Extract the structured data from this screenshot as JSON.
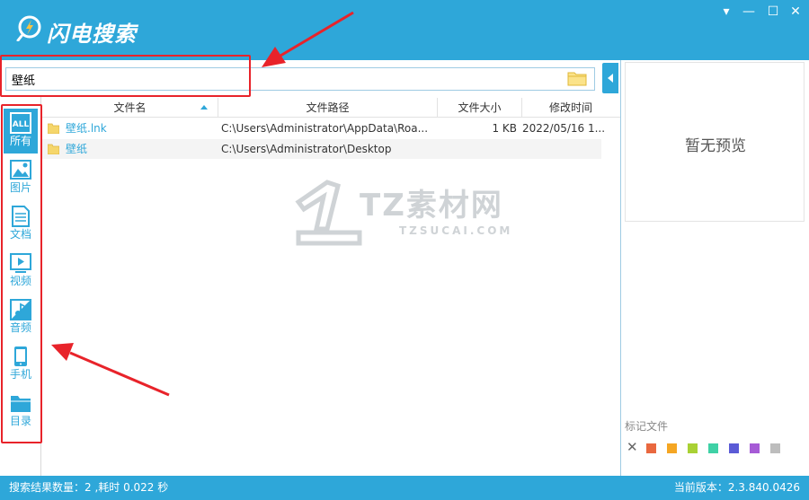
{
  "app": {
    "title": "闪电搜索"
  },
  "search": {
    "value": "壁纸",
    "placeholder": ""
  },
  "categories": [
    {
      "label": "所有",
      "icon": "all-icon",
      "active": true
    },
    {
      "label": "图片",
      "icon": "image-icon"
    },
    {
      "label": "文档",
      "icon": "document-icon"
    },
    {
      "label": "视频",
      "icon": "video-icon"
    },
    {
      "label": "音频",
      "icon": "audio-icon"
    },
    {
      "label": "手机",
      "icon": "phone-icon"
    },
    {
      "label": "目录",
      "icon": "folder-icon"
    }
  ],
  "table": {
    "columns": {
      "name": "文件名",
      "path": "文件路径",
      "size": "文件大小",
      "date": "修改时间"
    },
    "rows": [
      {
        "name": "壁纸.lnk",
        "path": "C:\\Users\\Administrator\\AppData\\Roa...",
        "size": "1 KB",
        "date": "2022/05/16 1..."
      },
      {
        "name": "壁纸",
        "path": "C:\\Users\\Administrator\\Desktop",
        "size": "",
        "date": ""
      }
    ]
  },
  "preview": {
    "empty_text": "暂无预览"
  },
  "marks": {
    "title": "标记文件",
    "colors": [
      "#e9683f",
      "#f5a623",
      "#a9d134",
      "#3fd1a6",
      "#5b5bd6",
      "#a65bd6",
      "#bdbdbd"
    ]
  },
  "watermark": {
    "text": "TZ素材网",
    "sub": "TZSUCAI.COM"
  },
  "status": {
    "left": "搜索结果数量：2 ,耗时 0.022 秒",
    "right": "当前版本：2.3.840.0426"
  },
  "colors": {
    "accent": "#2ea7d9",
    "annotation": "#e8232a"
  }
}
